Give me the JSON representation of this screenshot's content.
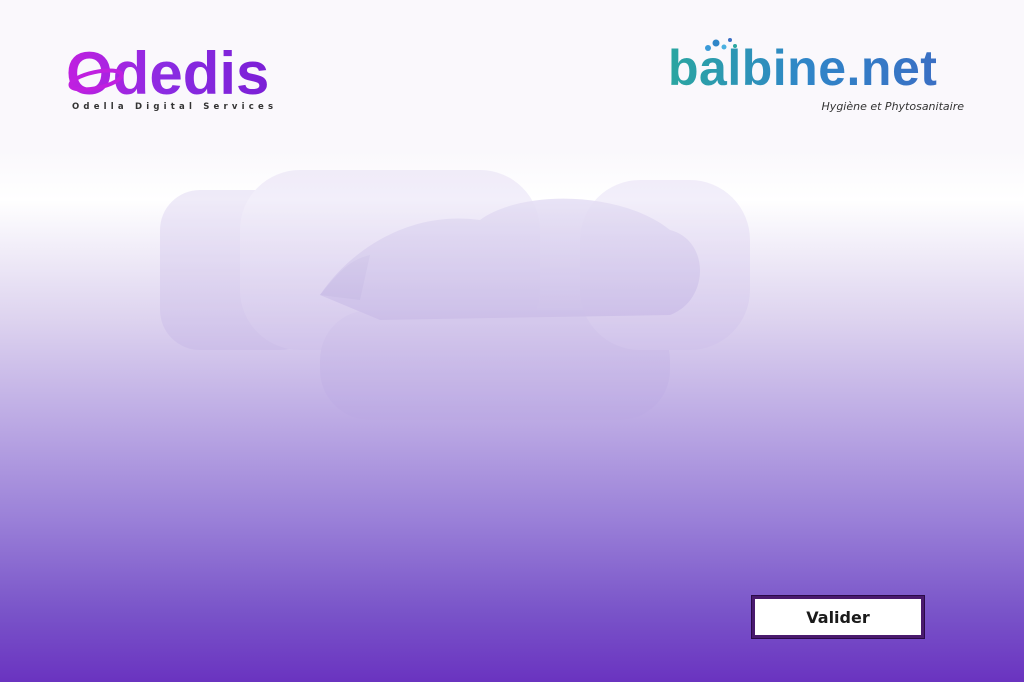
{
  "header": {
    "left_logo": {
      "name": "Odedis",
      "tagline": "Odella Digital Services",
      "brand_colors": [
        "#c020e0",
        "#7b1fd6"
      ]
    },
    "right_logo": {
      "name": "balbine.net",
      "tagline": "Hygiène et Phytosanitaire",
      "brand_colors": [
        "#2aa6a0",
        "#3a6fc4"
      ]
    }
  },
  "background": {
    "watermark_icon": "cloud-and-hand-icon",
    "gradient_colors": [
      "#faf8fc",
      "#6a33c0"
    ]
  },
  "actions": {
    "submit_label": "Valider"
  }
}
